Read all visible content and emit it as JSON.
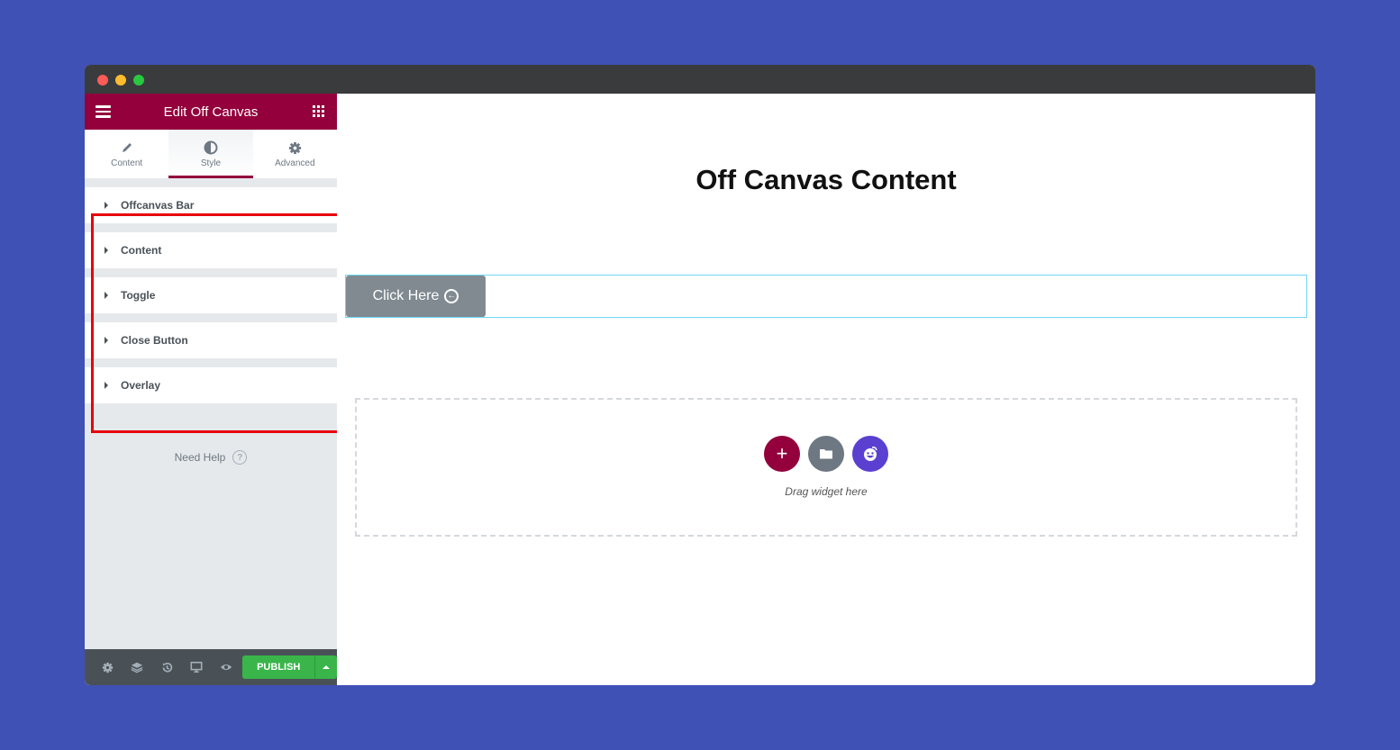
{
  "window": {
    "controls": [
      "close",
      "minimize",
      "maximize"
    ]
  },
  "panel": {
    "header_title": "Edit Off Canvas",
    "menu_icon": "hamburger-icon",
    "apps_icon": "grid-icon",
    "tabs": [
      {
        "label": "Content",
        "icon": "pencil-icon",
        "active": false
      },
      {
        "label": "Style",
        "icon": "half-circle-icon",
        "active": true
      },
      {
        "label": "Advanced",
        "icon": "gear-icon",
        "active": false
      }
    ],
    "sections": [
      {
        "label": "Offcanvas Bar"
      },
      {
        "label": "Content"
      },
      {
        "label": "Toggle"
      },
      {
        "label": "Close Button"
      },
      {
        "label": "Overlay"
      }
    ],
    "help_label": "Need Help",
    "help_icon": "?",
    "footer": {
      "icons": [
        "settings-icon",
        "layers-icon",
        "history-icon",
        "responsive-icon",
        "preview-icon"
      ],
      "publish_label": "PUBLISH"
    },
    "colors": {
      "brand": "#93003c",
      "publish": "#39b54a",
      "highlight": "#e8000b"
    }
  },
  "canvas": {
    "heading": "Off Canvas Content",
    "toggle_button_label": "Click Here",
    "dropzone": {
      "text": "Drag widget here",
      "add_symbol": "+"
    }
  }
}
